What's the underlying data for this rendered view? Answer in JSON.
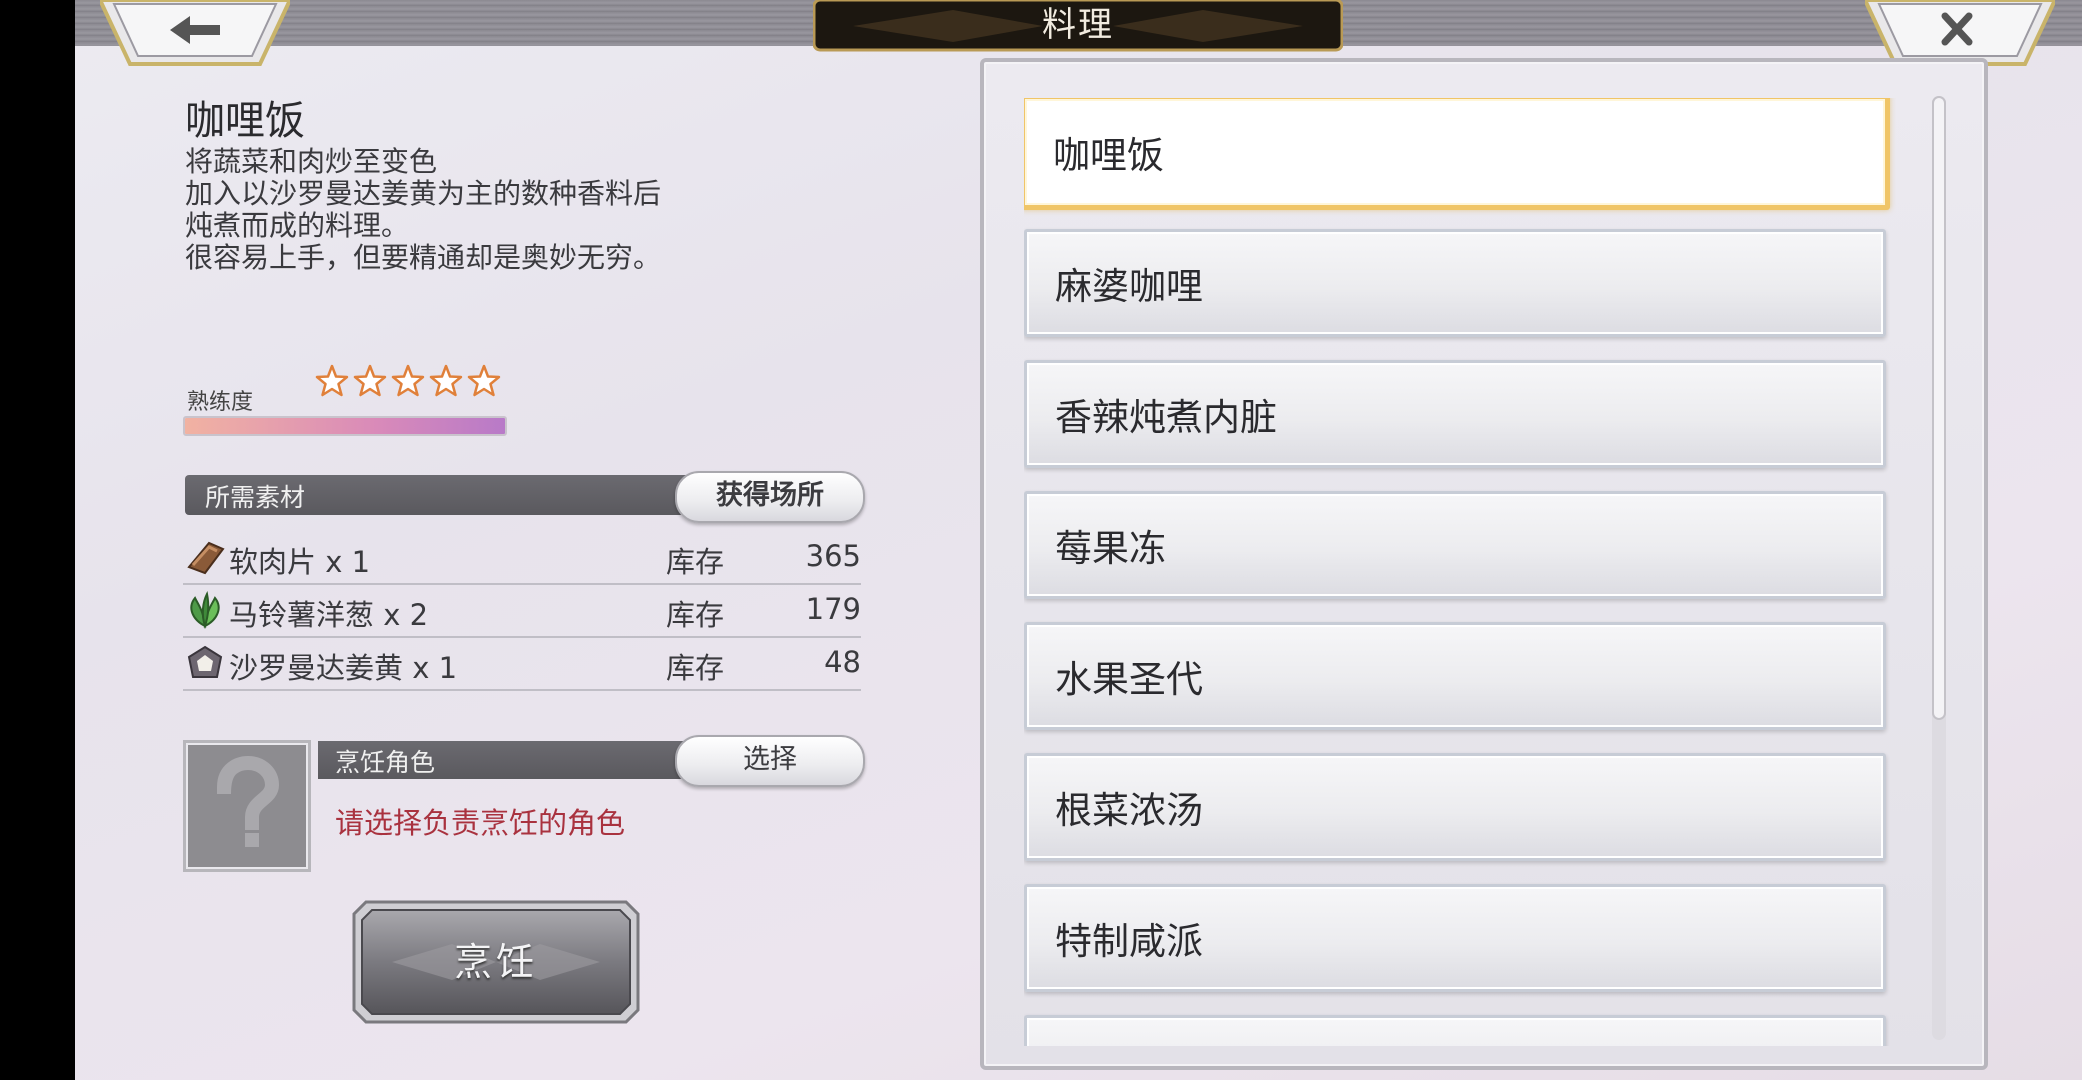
{
  "header": {
    "title": "料理",
    "back_icon": "arrow-left-icon",
    "close_icon": "close-icon"
  },
  "detail": {
    "name": "咖哩饭",
    "description": [
      "将蔬菜和肉炒至变色",
      "加入以沙罗曼达姜黄为主的数种香料后",
      "炖煮而成的料理。",
      "很容易上手，但要精通却是奥妙无穷。"
    ],
    "proficiency_label": "熟练度",
    "stars_total": 5,
    "stars_filled": 0
  },
  "materials": {
    "header": "所需素材",
    "source_button": "获得场所",
    "stock_label": "库存",
    "items": [
      {
        "name": "软肉片 x 1",
        "stock": "365",
        "icon": "meat-icon"
      },
      {
        "name": "马铃薯洋葱 x 2",
        "stock": "179",
        "icon": "herb-icon"
      },
      {
        "name": "沙罗曼达姜黄 x 1",
        "stock": "48",
        "icon": "spice-icon"
      }
    ]
  },
  "cook_role": {
    "header": "烹饪角色",
    "select_button": "选择",
    "hint": "请选择负责烹饪的角色",
    "portrait_icon": "question-mark-icon"
  },
  "cook_button": "烹饪",
  "recipe_list": {
    "items": [
      {
        "label": "咖哩饭",
        "selected": true
      },
      {
        "label": "麻婆咖哩",
        "selected": false
      },
      {
        "label": "香辣炖煮内脏",
        "selected": false
      },
      {
        "label": "莓果冻",
        "selected": false
      },
      {
        "label": "水果圣代",
        "selected": false
      },
      {
        "label": "根菜浓汤",
        "selected": false
      },
      {
        "label": "特制咸派",
        "selected": false
      },
      {
        "label": "",
        "selected": false
      }
    ]
  },
  "colors": {
    "selected_border": "#f0c567",
    "hint_text": "#a9323f",
    "star_outline": "#e0803a"
  }
}
